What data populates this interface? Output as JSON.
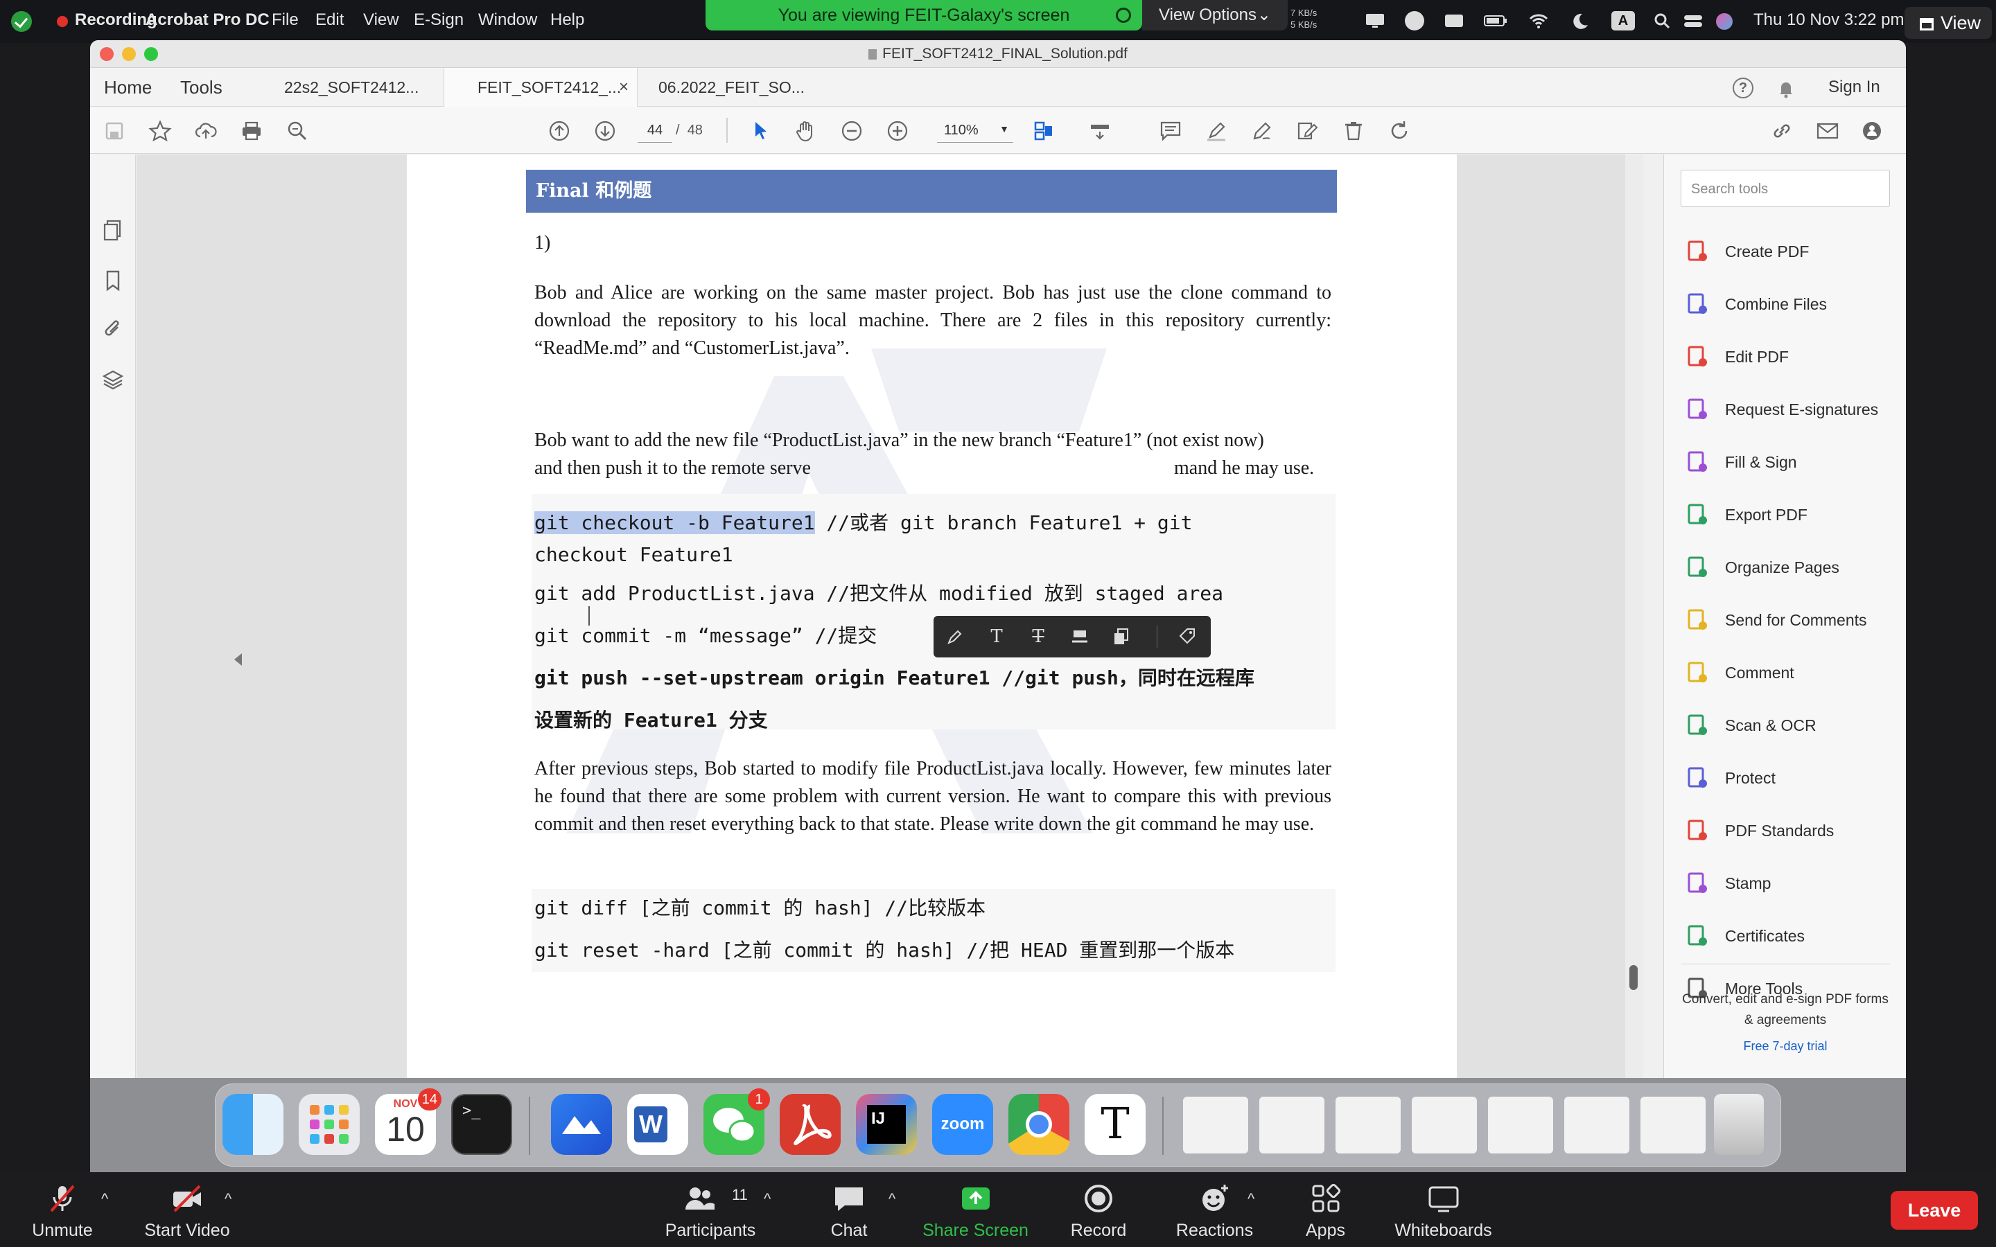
{
  "menubar": {
    "recording": "Recording",
    "app": "Acrobat Pro DC",
    "items": [
      "File",
      "Edit",
      "View",
      "E-Sign",
      "Window",
      "Help"
    ],
    "share_banner": "You are viewing FEIT-Galaxy's screen",
    "view_options": "View Options",
    "net_speed": [
      "7 KB/s",
      "5 KB/s"
    ],
    "clock": "Thu 10 Nov  3:22 pm",
    "view_button": "View"
  },
  "window": {
    "title": "FEIT_SOFT2412_FINAL_Solution.pdf",
    "nav": {
      "home": "Home",
      "tools": "Tools"
    },
    "tabs": [
      {
        "label": "22s2_SOFT2412..."
      },
      {
        "label": "FEIT_SOFT2412_...",
        "close": "×"
      },
      {
        "label": "06.2022_FEIT_SO..."
      }
    ],
    "sign_in": "Sign In"
  },
  "toolbar": {
    "page_current": "44",
    "page_sep": "/",
    "page_total": "48",
    "zoom": "110%"
  },
  "document": {
    "header": "Final 和例题",
    "q_number": "1)",
    "para1": "Bob and Alice are working on the same master project. Bob has just use the clone command to download the repository to his local machine. There are 2 files in this repository currently: “ReadMe.md” and “CustomerList.java”.",
    "para2_line1": "Bob want to add the new file “ProductList.java” in the new branch “Feature1” (not exist now)",
    "para2_line2a": "and then push it to the remote serve",
    "para2_line2b": "mand he may use.",
    "code1_selected": "git checkout -b Feature1",
    "code1_rest": " //或者 git branch Feature1 + git",
    "code1_line2": "checkout Feature1",
    "code2": "git add ProductList.java //把文件从 modified 放到 staged area",
    "code3": "git commit -m “message” //提交",
    "code4_line1": "git push --set-upstream origin Feature1 //git push，同时在远程库",
    "code4_line2": "设置新的 Feature1 分支",
    "para3": "After previous steps, Bob started to modify file ProductList.java locally. However, few minutes later he found that there are some problem with current version. He want to compare this with previous commit and then reset everything back to that state. Please write down the git command he may use.",
    "code5": "git diff [之前 commit 的 hash] //比较版本",
    "code6": "git reset -hard [之前 commit 的 hash] //把 HEAD 重置到那一个版本"
  },
  "tools_panel": {
    "search_placeholder": "Search tools",
    "items": [
      {
        "label": "Create PDF",
        "color": "#e0453c"
      },
      {
        "label": "Combine Files",
        "color": "#5b5fd6"
      },
      {
        "label": "Edit PDF",
        "color": "#e0453c"
      },
      {
        "label": "Request E-signatures",
        "color": "#9b4fd6"
      },
      {
        "label": "Fill & Sign",
        "color": "#9b4fd6"
      },
      {
        "label": "Export PDF",
        "color": "#2f9e62"
      },
      {
        "label": "Organize Pages",
        "color": "#2f9e62"
      },
      {
        "label": "Send for Comments",
        "color": "#e3b321"
      },
      {
        "label": "Comment",
        "color": "#e3b321"
      },
      {
        "label": "Scan & OCR",
        "color": "#2f9e62"
      },
      {
        "label": "Protect",
        "color": "#5b5fd6"
      },
      {
        "label": "PDF Standards",
        "color": "#e0453c"
      },
      {
        "label": "Stamp",
        "color": "#9b4fd6"
      },
      {
        "label": "Certificates",
        "color": "#2f9e62"
      },
      {
        "label": "More Tools",
        "color": "#555555"
      }
    ],
    "promo": "Convert, edit and e-sign PDF forms & agreements",
    "trial": "Free 7-day trial"
  },
  "dock": {
    "calendar_month": "NOV",
    "calendar_day": "10",
    "calendar_badge": "14",
    "wechat_badge": "1",
    "zoom_label": "zoom"
  },
  "zoombar": {
    "unmute": "Unmute",
    "start_video": "Start Video",
    "participants": "Participants",
    "participants_count": "11",
    "chat": "Chat",
    "share_screen": "Share Screen",
    "record": "Record",
    "reactions": "Reactions",
    "apps": "Apps",
    "whiteboards": "Whiteboards",
    "leave": "Leave"
  }
}
